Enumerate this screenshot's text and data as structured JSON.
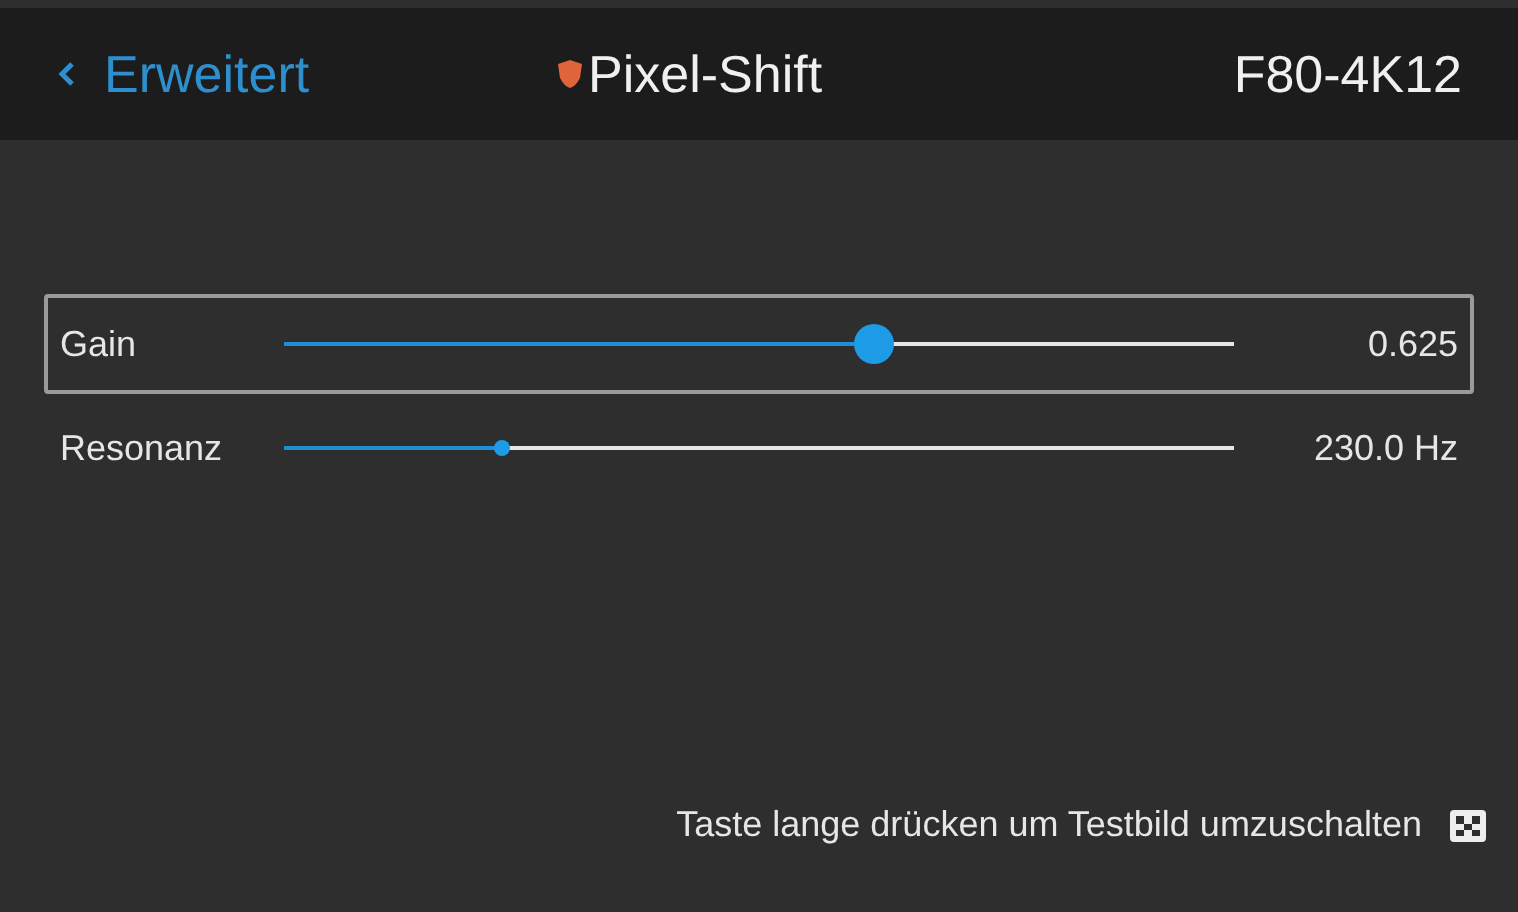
{
  "header": {
    "back": "Erweitert",
    "title": "Pixel-Shift",
    "model": "F80-4K12"
  },
  "sliders": [
    {
      "label": "Gain",
      "level": 0.62,
      "reading": "0.625",
      "selected": true
    },
    {
      "label": "Resonanz",
      "level": 0.23,
      "reading": "230.0 Hz",
      "selected": false
    }
  ],
  "hint": "Taste lange drücken um Testbild umzuschalten"
}
